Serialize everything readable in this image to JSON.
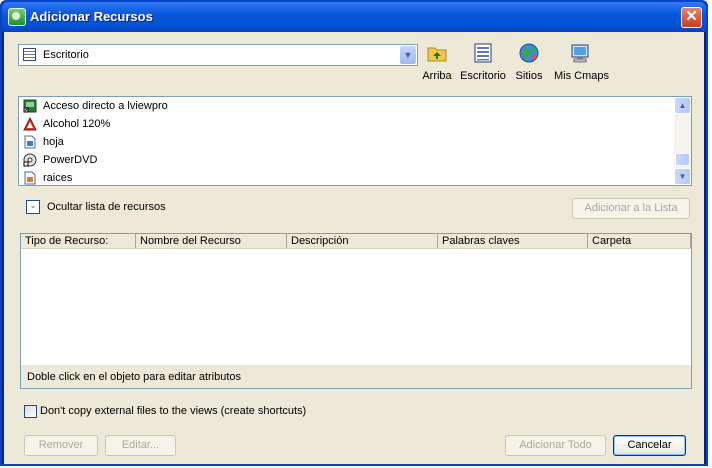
{
  "window": {
    "title": "Adicionar Recursos",
    "close_label": "✕"
  },
  "location": {
    "selected": "Escritorio",
    "dropdown_arrow": "▼"
  },
  "toolbar": {
    "up_label": "Arriba",
    "desktop_label": "Escritorio",
    "sites_label": "Sitios",
    "mycmaps_label": "Mis Cmaps"
  },
  "resources": [
    {
      "name": "Acceso directo a lviewpro",
      "icon": "shortcut-app-icon"
    },
    {
      "name": "Alcohol 120%",
      "icon": "alcohol-icon"
    },
    {
      "name": "hoja",
      "icon": "document-icon"
    },
    {
      "name": "PowerDVD",
      "icon": "powerdvd-icon"
    },
    {
      "name": "raices",
      "icon": "document-image-icon"
    }
  ],
  "scroll": {
    "up": "▲",
    "down": "▼"
  },
  "toggle": {
    "symbol": "-",
    "label": "Ocultar lista de recursos"
  },
  "add_to_list_label": "Adicionar a la Lista",
  "table": {
    "columns": [
      "Tipo de Recurso:",
      "Nombre del Recurso",
      "Descripción",
      "Palabras claves",
      "Carpeta"
    ],
    "hint": "Doble click en el objeto para editar atributos"
  },
  "copy_option": {
    "label": "Don't copy external files to the views (create shortcuts)",
    "checked": false
  },
  "buttons": {
    "remove": "Remover",
    "edit": "Editar...",
    "add_all": "Adicionar Todo",
    "cancel": "Cancelar"
  }
}
